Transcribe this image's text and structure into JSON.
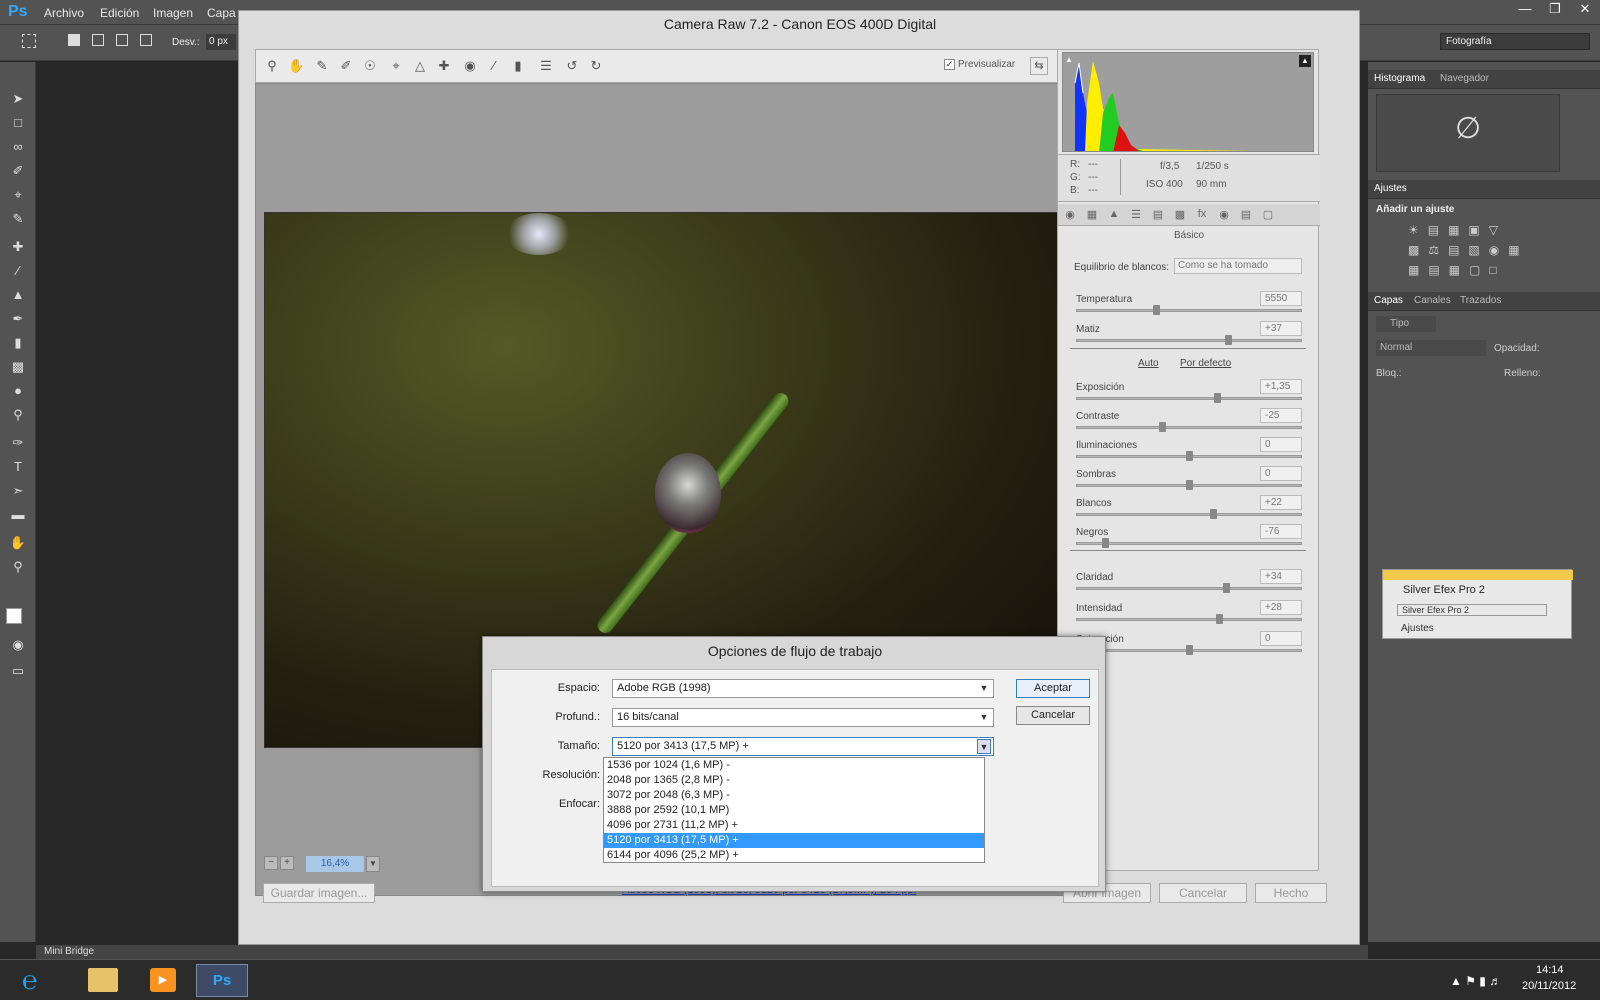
{
  "ps": {
    "logo": "Ps",
    "menu": [
      "Archivo",
      "Edición",
      "Imagen",
      "Capa"
    ],
    "options": {
      "desv_label": "Desv.:",
      "desv_value": "0 px"
    },
    "workspace": "Fotografía"
  },
  "right_panels": {
    "histograma_tabs": [
      "Histograma",
      "Navegador"
    ],
    "ajustes_tab": "Ajustes",
    "anadir_ajuste": "Añadir un ajuste",
    "capas_tabs": [
      "Capas",
      "Canales",
      "Trazados"
    ],
    "tipo_filter": "Tipo",
    "blend_mode": "Normal",
    "opacidad_label": "Opacidad:",
    "bloq_label": "Bloq.:",
    "relleno_label": "Relleno:"
  },
  "silver_efex": {
    "title": "Silver Efex Pro 2",
    "item": "Silver Efex Pro 2",
    "tab": "Ajustes"
  },
  "minibridge": {
    "label": "Mini Bridge"
  },
  "taskbar": {
    "time": "14:14",
    "date": "20/11/2012"
  },
  "camera_raw": {
    "title": "Camera Raw 7.2 -  Canon EOS 400D Digital",
    "preview_label": "Previsualizar",
    "zoom": "16,4%",
    "info": {
      "rgb_labels": [
        "R:",
        "G:",
        "B:"
      ],
      "rgb_values": [
        "---",
        "---",
        "---"
      ],
      "aperture": "f/3,5",
      "shutter": "1/250 s",
      "iso": "ISO 400",
      "focal": "90 mm"
    },
    "panel_title": "Básico",
    "wb_label": "Equilibrio de blancos:",
    "wb_value": "Como se ha tomado",
    "auto_link": "Auto",
    "default_link": "Por defecto",
    "sliders": [
      {
        "name": "Temperatura",
        "value": "5550",
        "pos": 0.35
      },
      {
        "name": "Matiz",
        "value": "+37",
        "pos": 0.68
      },
      {
        "name": "Exposición",
        "value": "+1,35",
        "pos": 0.63
      },
      {
        "name": "Contraste",
        "value": "-25",
        "pos": 0.38
      },
      {
        "name": "Iluminaciones",
        "value": "0",
        "pos": 0.5
      },
      {
        "name": "Sombras",
        "value": "0",
        "pos": 0.5
      },
      {
        "name": "Blancos",
        "value": "+22",
        "pos": 0.61
      },
      {
        "name": "Negros",
        "value": "-76",
        "pos": 0.12
      },
      {
        "name": "Claridad",
        "value": "+34",
        "pos": 0.67
      },
      {
        "name": "Intensidad",
        "value": "+28",
        "pos": 0.64
      },
      {
        "name": "Saturación",
        "value": "0",
        "pos": 0.5
      }
    ],
    "buttons": {
      "save": "Guardar imagen...",
      "open": "Abrir imagen",
      "cancel": "Cancelar",
      "done": "Hecho"
    },
    "workflow_link": "Adobe RGB (1998); bit 16; 5120 por 3413 (17,5MP); 254 ppi"
  },
  "workflow_dialog": {
    "title": "Opciones de flujo de trabajo",
    "espacio_label": "Espacio:",
    "espacio_value": "Adobe RGB (1998)",
    "profund_label": "Profund.:",
    "profund_value": "16 bits/canal",
    "tamano_label": "Tamaño:",
    "tamano_value": "5120 por 3413  (17,5 MP)  +",
    "resolucion_label": "Resolución:",
    "enfocar_label": "Enfocar:",
    "accept": "Aceptar",
    "cancel": "Cancelar",
    "size_options": [
      "1536 por 1024  (1,6 MP)  -",
      "2048 por 1365  (2,8 MP)  -",
      "3072 por 2048  (6,3 MP)  -",
      "3888 por 2592  (10,1 MP)",
      "4096 por 2731  (11,2 MP)  +",
      "5120 por 3413  (17,5 MP)  +",
      "6144 por 4096  (25,2 MP)  +"
    ],
    "selected_index": 5
  }
}
